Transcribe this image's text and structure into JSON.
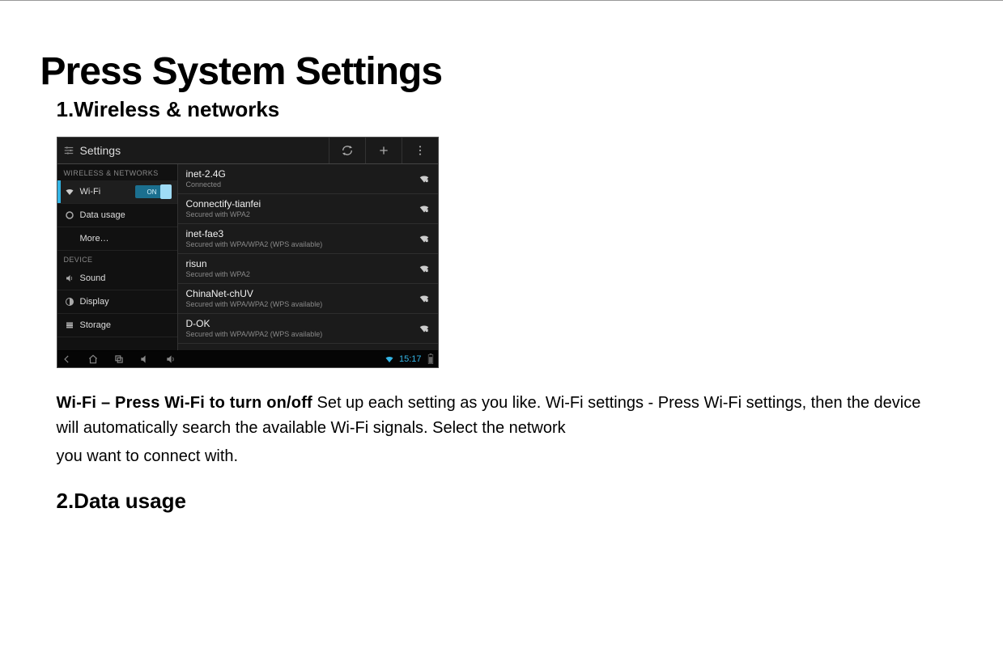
{
  "doc": {
    "title": "Press System Settings",
    "section1": "1.Wireless & networks",
    "wifi_bold": "Wi-Fi – Press Wi-Fi to turn on/off",
    "para_rest": " Set up each setting as you like. Wi-Fi settings - Press Wi-Fi settings, then the device",
    "para_line2": "will automatically search the available Wi-Fi signals. Select the network",
    "para_line3": "you want to connect with.",
    "section2": "2.Data usage"
  },
  "shot": {
    "title": "Settings",
    "toggle_label": "ON",
    "sidebar_headers": {
      "wireless": "WIRELESS & NETWORKS",
      "device": "DEVICE"
    },
    "sidebar": [
      {
        "label": "Wi-Fi",
        "icon": "wifi"
      },
      {
        "label": "Data usage",
        "icon": "data"
      },
      {
        "label": "More…",
        "icon": "none"
      },
      {
        "label": "Sound",
        "icon": "sound"
      },
      {
        "label": "Display",
        "icon": "display"
      },
      {
        "label": "Storage",
        "icon": "storage"
      }
    ],
    "networks": [
      {
        "name": "inet-2.4G",
        "sub": "Connected"
      },
      {
        "name": "Connectify-tianfei",
        "sub": "Secured with WPA2"
      },
      {
        "name": "inet-fae3",
        "sub": "Secured with WPA/WPA2 (WPS available)"
      },
      {
        "name": "risun",
        "sub": "Secured with WPA2"
      },
      {
        "name": "ChinaNet-chUV",
        "sub": "Secured with WPA/WPA2 (WPS available)"
      },
      {
        "name": "D-OK",
        "sub": "Secured with WPA/WPA2 (WPS available)"
      }
    ],
    "clock": "15:17"
  }
}
